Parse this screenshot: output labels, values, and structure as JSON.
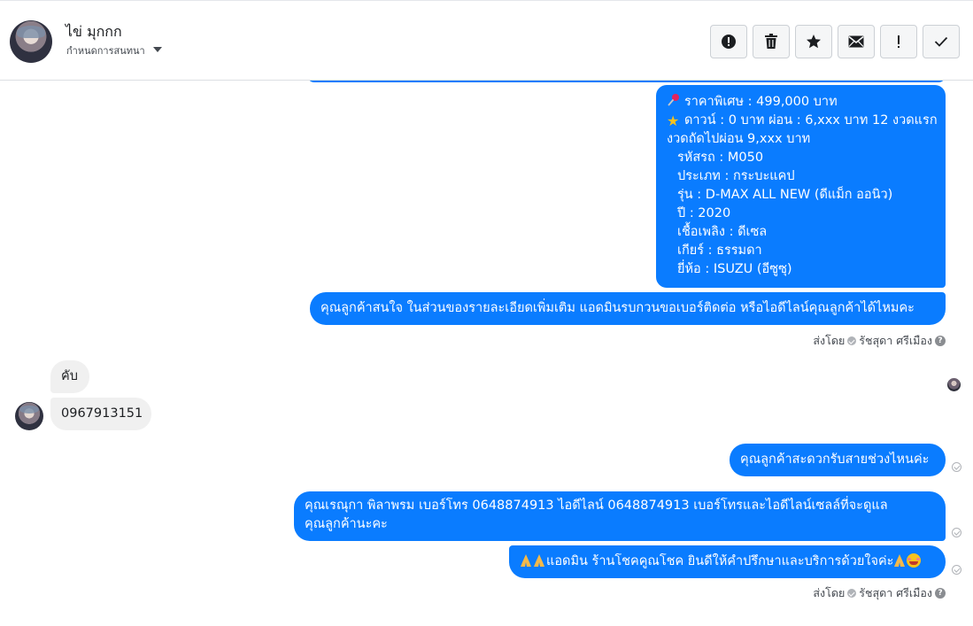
{
  "header": {
    "contact_name": "ไข่ มุกกก",
    "assign_label": "กำหนดการสนทนา",
    "actions": [
      {
        "icon": "alert-circle-icon",
        "label": "spam"
      },
      {
        "icon": "trash-icon",
        "label": "delete"
      },
      {
        "icon": "star-icon",
        "label": "star"
      },
      {
        "icon": "envelope-icon",
        "label": "mark unread"
      },
      {
        "icon": "exclamation-icon",
        "label": "follow up"
      },
      {
        "icon": "checkmark-icon",
        "label": "done"
      }
    ]
  },
  "messages": {
    "car_details": {
      "price": "ราคาพิเศษ : 499,000 บาท",
      "down": "ดาวน์ : 0 บาท ผ่อน : 6,xxx บาท 12 งวดแรก",
      "next": "งวดถัดไปผ่อน  9,xxx บาท",
      "code": "รหัสรถ : M050",
      "type": "ประเภท : กระบะแคป",
      "model": "รุ่น : D-MAX ALL NEW (ดีแม็ก ออนิว)",
      "year": "ปี : 2020",
      "fuel": "เชื้อเพลิง : ดีเซล",
      "gear": "เกียร์ : ธรรมดา",
      "brand": "ยี่ห้อ : ISUZU (อีซูซุ)"
    },
    "interest": "คุณลูกค้าสนใจ ในส่วนของรายละเอียดเพิ่มเติม แอดมินรบกวนขอเบอร์ติดต่อ หรือไอดีไลน์คุณลูกค้าได้ไหมคะ",
    "sent_by_1": {
      "prefix": "ส่งโดย",
      "name": "รัชสุดา ศรีเมือง"
    },
    "reply_1": "คับ",
    "reply_2": "0967913151",
    "convenient": "คุณลูกค้าสะดวกรับสายช่วงไหนค่ะ",
    "agent_contact_line1": "คุณเรณุกา พิลาพรม        เบอร์โทร 0648874913  ไอดีไลน์ 0648874913   เบอร์โทรและไอดีไลน์เซลล์ที่จะดูแล",
    "agent_contact_line2": "คุณลูกค้านะคะ",
    "thanks": "แอดมิน ร้านโชคคูณโชค ยินดีให้คำปรึกษาและบริการด้วยใจค่ะ",
    "sent_by_2": {
      "prefix": "ส่งโดย",
      "name": "รัชสุดา ศรีเมือง"
    }
  },
  "colors": {
    "outgoing": "#0a7cff",
    "incoming": "#f0f0f0"
  }
}
